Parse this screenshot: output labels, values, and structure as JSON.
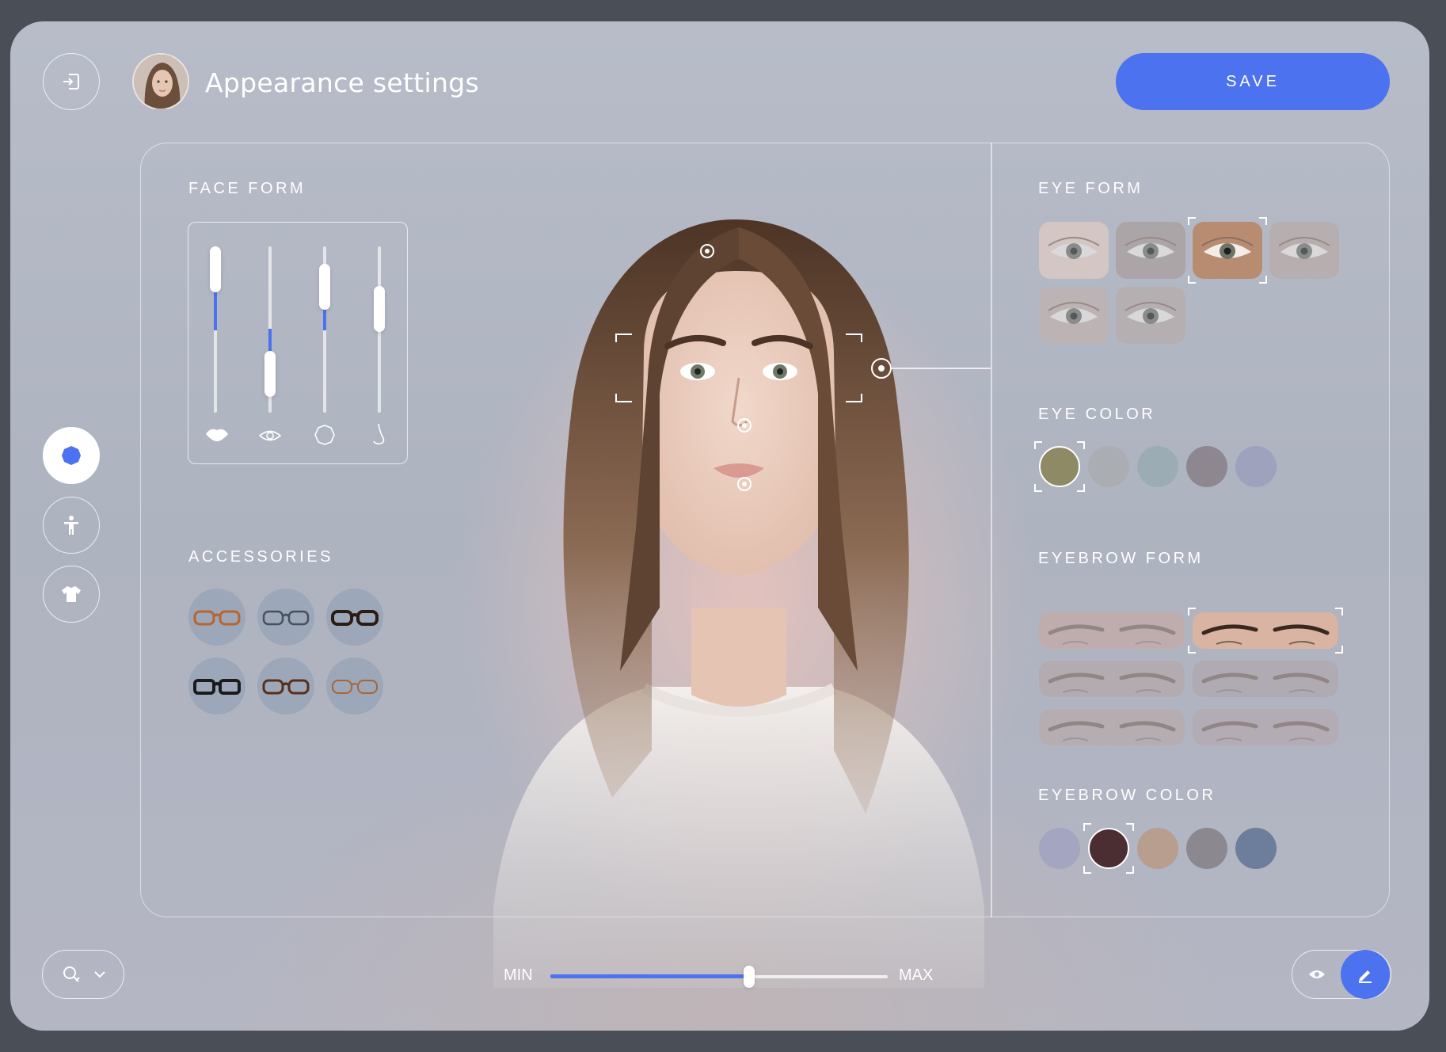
{
  "header": {
    "title": "Appearance settings",
    "save_label": "SAVE"
  },
  "face_form": {
    "label": "FACE FORM",
    "sliders": [
      {
        "icon": "lips-icon",
        "value": 0.5
      },
      {
        "icon": "eye-icon",
        "value": 0.2
      },
      {
        "icon": "face-shape-icon",
        "value": 0.6
      },
      {
        "icon": "nose-icon",
        "value": 0.0
      }
    ]
  },
  "accessories": {
    "label": "ACCESSORIES",
    "items": [
      "glasses-orange",
      "glasses-clear",
      "glasses-tortoise",
      "glasses-black",
      "glasses-brown",
      "glasses-thin-orange"
    ]
  },
  "eye_form": {
    "label": "EYE FORM",
    "selected_index": 2,
    "count": 6
  },
  "eye_color": {
    "label": "EYE COLOR",
    "selected_index": 0,
    "colors": [
      "#8e8a66",
      "#aaaeb3",
      "#9cacb4",
      "#8e8790",
      "#9ea2bd"
    ]
  },
  "eyebrow_form": {
    "label": "EYEBROW FORM",
    "selected_index": 1,
    "count": 6
  },
  "eyebrow_color": {
    "label": "EYEBROW COLOR",
    "selected_index": 1,
    "colors": [
      "#a4a5c0",
      "#4a2e31",
      "#b89e8f",
      "#8c8890",
      "#6c7e9b"
    ]
  },
  "intensity_slider": {
    "min_label": "MIN",
    "max_label": "MAX",
    "value": 0.59
  },
  "sidebar": {
    "items": [
      "face-icon",
      "body-icon",
      "shirt-icon"
    ],
    "active_index": 0
  },
  "colors": {
    "accent": "#4c72f0"
  }
}
